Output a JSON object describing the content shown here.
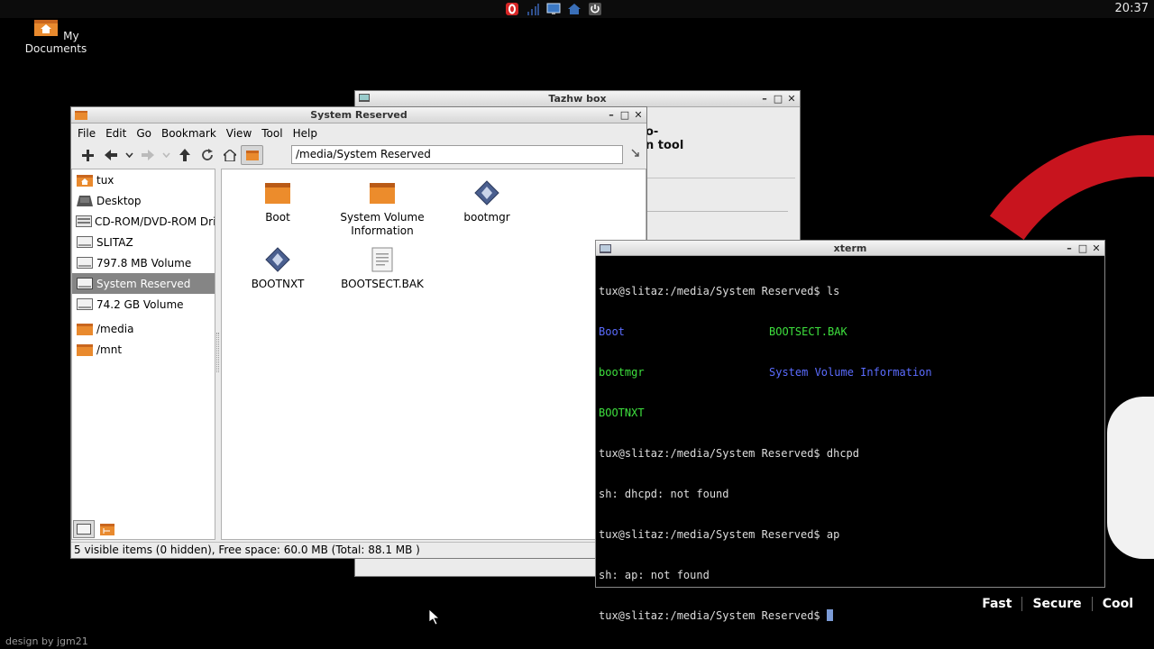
{
  "panel": {
    "clock": "20:37",
    "tray": [
      {
        "icon": "opera-icon",
        "color": "#d62626"
      },
      {
        "icon": "network-signal-icon",
        "color": "#2a4a8a"
      },
      {
        "icon": "monitor-icon",
        "color": "#3b78c4"
      },
      {
        "icon": "home-icon",
        "color": "#3a6fb8"
      },
      {
        "icon": "power-icon",
        "color": "#dddddd"
      }
    ]
  },
  "desktop": {
    "icon_label": "My Documents",
    "credit": "design by jgm21",
    "slogan": [
      "Fast",
      "Secure",
      "Cool"
    ]
  },
  "tazhw": {
    "title": "Tazhw box",
    "partial_line1": "o-",
    "partial_line2": "n tool"
  },
  "filemanager": {
    "title": "System Reserved",
    "menu": [
      "File",
      "Edit",
      "Go",
      "Bookmark",
      "View",
      "Tool",
      "Help"
    ],
    "address": "/media/System Reserved",
    "sidebar": [
      {
        "label": "tux",
        "icon": "home-folder-icon"
      },
      {
        "label": "Desktop",
        "icon": "desktop-icon"
      },
      {
        "label": "CD-ROM/DVD-ROM Drive",
        "icon": "drive-icon"
      },
      {
        "label": "SLITAZ",
        "icon": "drive-icon"
      },
      {
        "label": "797.8 MB Volume",
        "icon": "drive-icon"
      },
      {
        "label": "System Reserved",
        "icon": "drive-icon",
        "selected": true
      },
      {
        "label": "74.2 GB Volume",
        "icon": "drive-icon"
      }
    ],
    "bookmarks": [
      {
        "label": "/media",
        "icon": "folder-icon"
      },
      {
        "label": "/mnt",
        "icon": "folder-icon"
      }
    ],
    "files": [
      {
        "name": "Boot",
        "icon": "folder-icon"
      },
      {
        "name": "System Volume Information",
        "icon": "folder-icon"
      },
      {
        "name": "bootmgr",
        "icon": "executable-icon"
      },
      {
        "name": "BOOTNXT",
        "icon": "executable-icon"
      },
      {
        "name": "BOOTSECT.BAK",
        "icon": "text-file-icon"
      }
    ],
    "status": "5 visible items (0 hidden), Free space: 60.0 MB (Total: 88.1 MB )"
  },
  "xterm": {
    "title": "xterm",
    "prompt": "tux@slitaz:/media/System Reserved$",
    "cmd1": "ls",
    "ls_row1_a": "Boot",
    "ls_row1_b": "BOOTSECT.BAK",
    "ls_row2_a": "bootmgr",
    "ls_row2_b": "System Volume Information",
    "ls_row3_a": "BOOTNXT",
    "cmd2": "dhcpd",
    "err2": "sh: dhcpd: not found",
    "cmd3": "ap",
    "err3": "sh: ap: not found"
  }
}
